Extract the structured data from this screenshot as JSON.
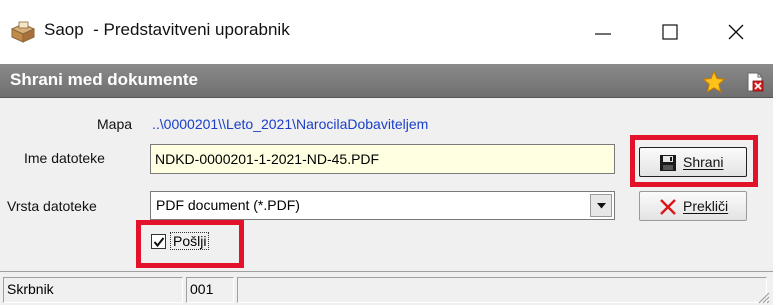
{
  "window": {
    "title": "Saop  - Predstavitveni uporabnik",
    "controls": [
      "minimize-icon",
      "maximize-icon",
      "close-icon"
    ]
  },
  "header": {
    "title": "Shrani med dokumente",
    "icons": [
      "star-icon",
      "document-close-icon"
    ]
  },
  "form": {
    "folder_label": "Mapa",
    "folder_value": "..\\0000201\\\\Leto_2021\\NarocilaDobaviteljem",
    "filename_label": "Ime datoteke",
    "filename_value": "NDKD-0000201-1-2021-ND-45.PDF",
    "filetype_label": "Vrsta datoteke",
    "filetype_value": "PDF document (*.PDF)",
    "send_label": "Pošlji",
    "send_checked": true
  },
  "buttons": {
    "save_label": "Shrani",
    "cancel_label": "Prekliči"
  },
  "statusbar": {
    "cells": [
      "Skrbnik",
      "001",
      ""
    ]
  },
  "colors": {
    "header_band": "#7d7d7d",
    "link_blue": "#1a3ec9",
    "input_bg": "#ffffe1",
    "highlight": "#e3122a"
  }
}
